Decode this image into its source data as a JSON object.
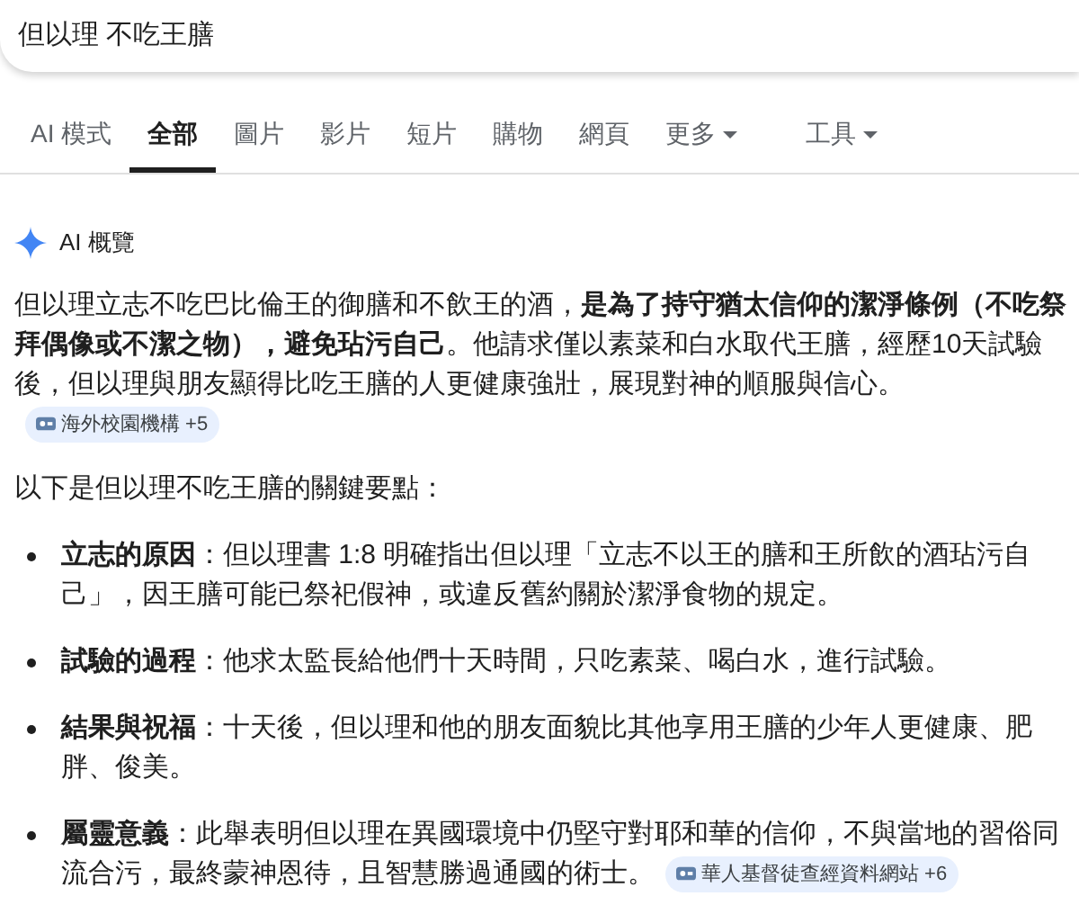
{
  "search": {
    "value": "但以理 不吃王膳"
  },
  "tabs": [
    {
      "label": "AI 模式",
      "selected": false,
      "kind": "link"
    },
    {
      "label": "全部",
      "selected": true,
      "kind": "link"
    },
    {
      "label": "圖片",
      "selected": false,
      "kind": "link"
    },
    {
      "label": "影片",
      "selected": false,
      "kind": "link"
    },
    {
      "label": "短片",
      "selected": false,
      "kind": "link"
    },
    {
      "label": "購物",
      "selected": false,
      "kind": "link"
    },
    {
      "label": "網頁",
      "selected": false,
      "kind": "link"
    },
    {
      "label": "更多",
      "selected": false,
      "kind": "dropdown"
    },
    {
      "label": "工具",
      "selected": false,
      "kind": "dropdown"
    }
  ],
  "ai_overview": {
    "title": "AI 概覽",
    "summary": "但以理立志不吃巴比倫王的御膳和不飲王的酒，**是為了持守猶太信仰的潔淨條例（不吃祭拜偶像或不潔之物），避免玷污自己**。他請求僅以素菜和白水取代王膳，經歷10天試驗後，但以理與朋友顯得比吃王膳的人更健康強壯，展現對神的順服與信心。",
    "summary_source": {
      "label": "海外校園機構",
      "count": "+5"
    },
    "intro": "以下是但以理不吃王膳的關鍵要點：",
    "points": [
      {
        "label": "立志的原因",
        "text": "：但以理書 1:8 明確指出但以理「立志不以王的膳和王所飲的酒玷污自己」，因王膳可能已祭祀假神，或違反舊約關於潔淨食物的規定。"
      },
      {
        "label": "試驗的過程",
        "text": "：他求太監長給他們十天時間，只吃素菜、喝白水，進行試驗。"
      },
      {
        "label": "結果與祝福",
        "text": "：十天後，但以理和他的朋友面貌比其他享用王膳的少年人更健康、肥胖、俊美。"
      },
      {
        "label": "屬靈意義",
        "text": "：此舉表明但以理在異國環境中仍堅守對耶和華的信仰，不與當地的習俗同流合污，最終蒙神恩待，且智慧勝過通國的術士。",
        "source": {
          "label": "華人基督徒查經資料網站",
          "count": "+6"
        }
      }
    ]
  }
}
